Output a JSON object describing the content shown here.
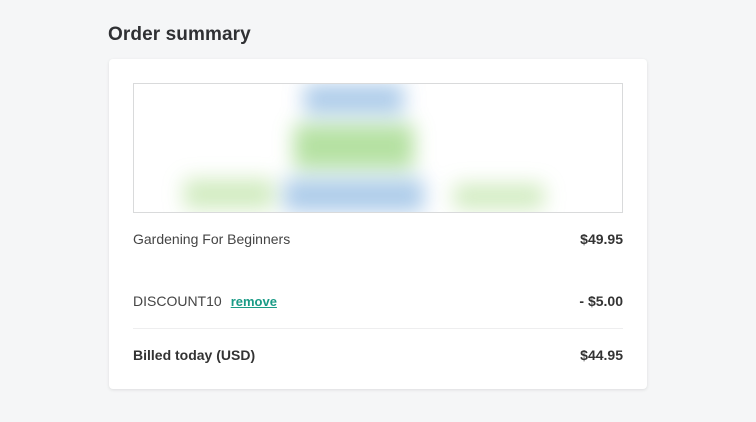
{
  "page": {
    "title": "Order summary"
  },
  "product": {
    "name": "Gardening For Beginners",
    "price": "$49.95"
  },
  "discount": {
    "code": "DISCOUNT10",
    "remove_label": "remove",
    "amount": "- $5.00"
  },
  "total": {
    "label": "Billed today (USD)",
    "amount": "$44.95"
  },
  "colors": {
    "accent": "#1a9b86",
    "background": "#f5f6f7",
    "card": "#ffffff"
  }
}
